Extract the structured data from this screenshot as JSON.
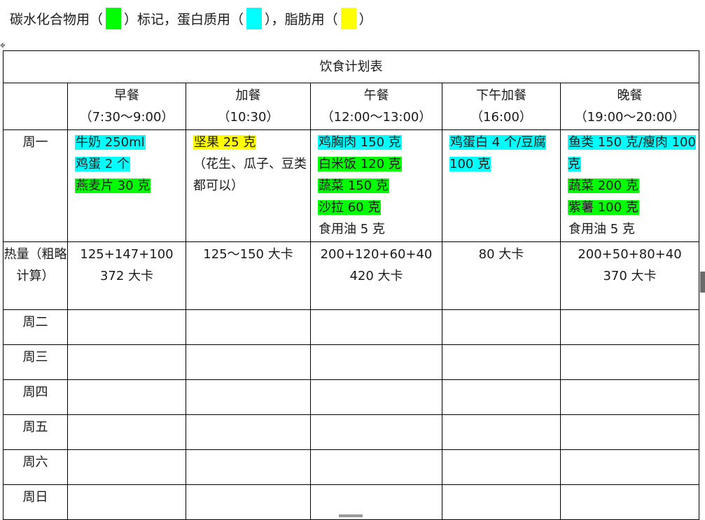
{
  "legend": {
    "carb_prefix": "碳水化合物用（",
    "carb_suffix": "）标记，",
    "protein_prefix": "蛋白质用（",
    "protein_suffix": "），",
    "fat_prefix": "脂肪用（",
    "fat_suffix": "）"
  },
  "colors": {
    "carb": "#00ff00",
    "protein": "#00ffff",
    "fat": "#ffff00"
  },
  "table": {
    "title": "饮食计划表",
    "meals": [
      {
        "name": "早餐",
        "time": "（7:30～9:00）"
      },
      {
        "name": "加餐",
        "time": "（10:30）"
      },
      {
        "name": "午餐",
        "time": "（12:00～13:00）"
      },
      {
        "name": "下午加餐",
        "time": "（16:00）"
      },
      {
        "name": "晚餐",
        "time": "（19:00～20:00）"
      }
    ],
    "monday": {
      "day": "周一",
      "breakfast": [
        "牛奶 250ml",
        "鸡蛋 2 个",
        "燕麦片 30 克"
      ],
      "snack_am": {
        "nuts": "坚果 25 克",
        "note": "（花生、瓜子、豆类都可以）"
      },
      "lunch": [
        "鸡胸肉 150 克",
        "白米饭 120 克",
        "蔬菜 150 克",
        "沙拉 60 克",
        "食用油 5 克"
      ],
      "snack_pm": "鸡蛋白 4 个/豆腐 100 克",
      "dinner": {
        "protein": "鱼类 150 克/瘦肉 100 克",
        "veg": "蔬菜 200 克",
        "potato": "紫薯 100 克",
        "oil": "食用油 5 克"
      }
    },
    "calories": {
      "label": "热量（粗略计算）",
      "breakfast": [
        "125+147+100",
        "372 大卡"
      ],
      "snack_am": [
        "125～150 大卡"
      ],
      "lunch": [
        "200+120+60+40",
        "420 大卡"
      ],
      "snack_pm": [
        "80 大卡"
      ],
      "dinner": [
        "200+50+80+40",
        "370 大卡"
      ]
    },
    "days": [
      "周二",
      "周三",
      "周四",
      "周五",
      "周六",
      "周日"
    ]
  }
}
